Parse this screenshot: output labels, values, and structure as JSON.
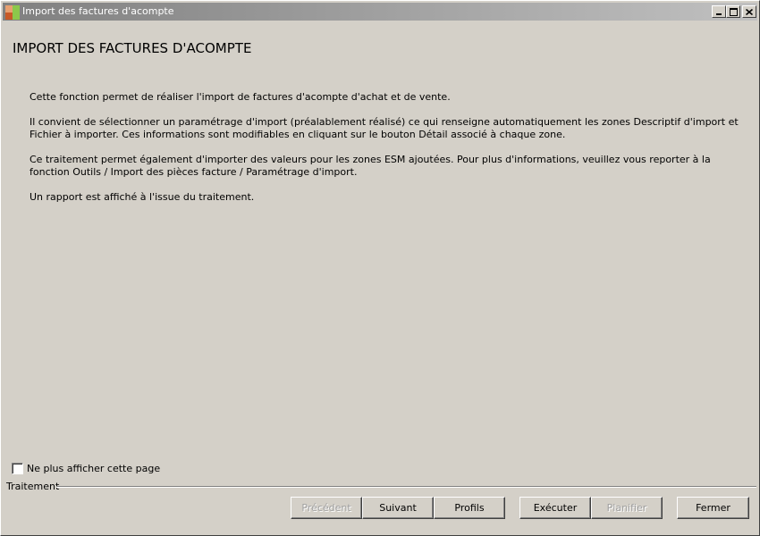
{
  "window": {
    "title": "Import des factures d'acompte",
    "controls": {
      "minimize": "minimize",
      "maximize": "maximize",
      "close": "close"
    }
  },
  "page": {
    "title": "IMPORT DES FACTURES D'ACOMPTE",
    "paragraphs": [
      "Cette fonction permet de réaliser l'import de factures d'acompte d'achat et de vente.",
      "Il convient de sélectionner un paramétrage d'import (préalablement réalisé) ce qui renseigne automatiquement les zones Descriptif d'import et Fichier à importer. Ces informations sont modifiables en cliquant sur le bouton Détail associé à chaque zone.",
      "Ce traitement permet également d'importer des valeurs pour les zones ESM ajoutées. Pour plus d'informations, veuillez vous reporter à la fonction Outils / Import des pièces facture / Paramétrage d'import.",
      "Un rapport est affiché à l'issue du traitement."
    ]
  },
  "options": {
    "hide_page_label": "Ne plus afficher cette page",
    "hide_page_checked": false
  },
  "group": {
    "label": "Traitement"
  },
  "buttons": {
    "previous": "Précédent",
    "next": "Suivant",
    "profiles": "Profils",
    "execute": "Exécuter",
    "schedule": "Planifier",
    "close": "Fermer"
  },
  "colors": {
    "window_bg": "#d4d0c8",
    "titlebar_start": "#808080",
    "titlebar_end": "#c0c0c0",
    "disabled_text": "#a0a0a0"
  }
}
